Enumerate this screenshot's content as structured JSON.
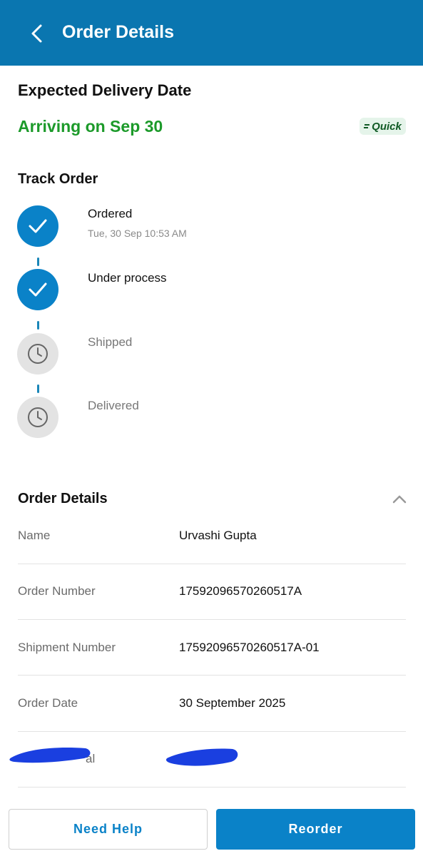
{
  "header": {
    "title": "Order Details",
    "back_icon": "chevron-left-icon"
  },
  "delivery": {
    "title": "Expected Delivery Date",
    "arriving": "Arriving on Sep 30",
    "badge": "Quick"
  },
  "track": {
    "title": "Track Order",
    "steps": [
      {
        "label": "Ordered",
        "time": "Tue, 30 Sep 10:53 AM",
        "status": "done"
      },
      {
        "label": "Under process",
        "status": "done"
      },
      {
        "label": "Shipped",
        "status": "pending"
      },
      {
        "label": "Delivered",
        "status": "pending"
      }
    ]
  },
  "order_details": {
    "title": "Order Details",
    "rows": [
      {
        "label": "Name",
        "value": "Urvashi Gupta"
      },
      {
        "label": "Order Number",
        "value": "17592096570260517A"
      },
      {
        "label": "Shipment Number",
        "value": "17592096570260517A-01"
      },
      {
        "label": "Order Date",
        "value": "30 September 2025"
      },
      {
        "label": "al",
        "value": ""
      }
    ]
  },
  "actions": {
    "help": "Need Help",
    "reorder": "Reorder"
  },
  "colors": {
    "header": "#0a76b0",
    "accent": "#0a82c8",
    "success": "#1c9a2a",
    "redaction": "#1a3fe0"
  }
}
